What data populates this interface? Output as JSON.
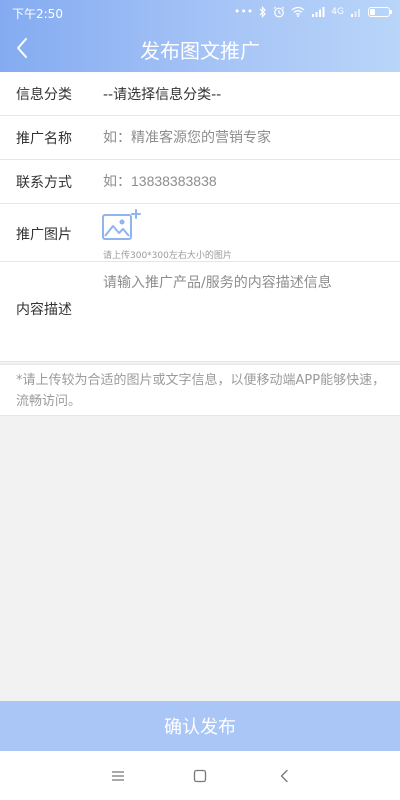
{
  "status_bar": {
    "time": "下午2:50",
    "icons": [
      "dots-icon",
      "bluetooth-icon",
      "alarm-icon",
      "wifi-icon",
      "signal-icon",
      "signal-icon",
      "battery-icon"
    ],
    "signal_label": "4G",
    "battery_level": 0.3
  },
  "header": {
    "title": "发布图文推广",
    "back_icon": "chevron-left-icon",
    "color_start": "#84abf1",
    "color_end": "#b9d5f9"
  },
  "form": {
    "category": {
      "label": "信息分类",
      "value": "--请选择信息分类--"
    },
    "name": {
      "label": "推广名称",
      "placeholder": "如：精准客源您的营销专家"
    },
    "contact": {
      "label": "联系方式",
      "placeholder": "如：13838383838"
    },
    "image": {
      "label": "推广图片",
      "hint": "请上传300*300左右大小的图片",
      "icon": "image-add-icon"
    },
    "description": {
      "label": "内容描述",
      "placeholder": "请输入推广产品/服务的内容描述信息"
    }
  },
  "tip": "*请上传较为合适的图片或文字信息，以便移动端APP能够快速，流畅访问。",
  "submit": {
    "label": "确认发布",
    "color": "#a9c6f6"
  },
  "nav_bar": {
    "icons": [
      "menu-icon",
      "home-icon",
      "back-icon"
    ]
  }
}
